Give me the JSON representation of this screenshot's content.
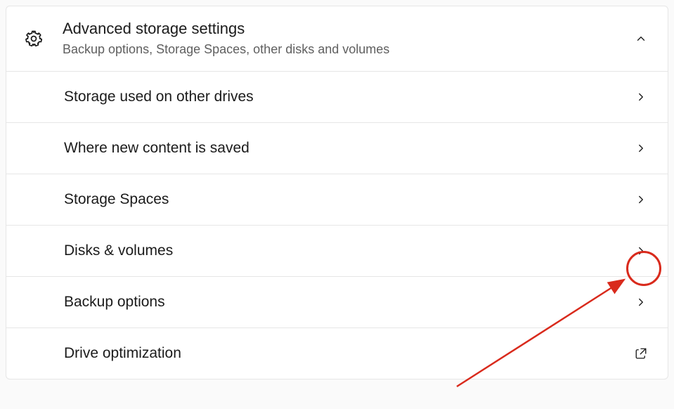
{
  "header": {
    "title": "Advanced storage settings",
    "subtitle": "Backup options, Storage Spaces, other disks and volumes"
  },
  "items": [
    {
      "label": "Storage used on other drives",
      "icon": "chevron-right"
    },
    {
      "label": "Where new content is saved",
      "icon": "chevron-right"
    },
    {
      "label": "Storage Spaces",
      "icon": "chevron-right"
    },
    {
      "label": "Disks & volumes",
      "icon": "chevron-right"
    },
    {
      "label": "Backup options",
      "icon": "chevron-right"
    },
    {
      "label": "Drive optimization",
      "icon": "external-link"
    }
  ],
  "annotation": {
    "target_item_index": 3,
    "color": "#d92a1c"
  }
}
